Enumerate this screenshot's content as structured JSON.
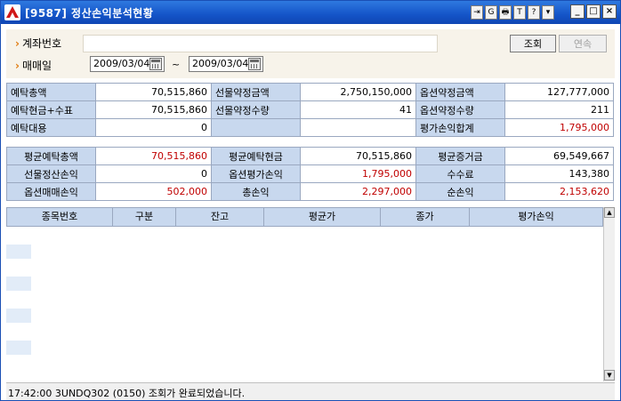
{
  "window": {
    "title": "[9587] 정산손익분석현황",
    "tools": [
      "⇥",
      "G",
      "🖶",
      "T",
      "?"
    ],
    "controls": [
      "_",
      "□",
      "×"
    ]
  },
  "search": {
    "account_label": "계좌번호",
    "account_value": "",
    "date_label": "매매일",
    "date_from": "2009/03/04",
    "date_to": "2009/03/04",
    "range_sep": "~",
    "query_button": "조회",
    "next_button": "연속"
  },
  "summary1": [
    [
      {
        "label": "예탁총액",
        "value": "70,515,860"
      },
      {
        "label": "선물약정금액",
        "value": "2,750,150,000"
      },
      {
        "label": "옵션약정금액",
        "value": "127,777,000"
      }
    ],
    [
      {
        "label": "예탁현금+수표",
        "value": "70,515,860"
      },
      {
        "label": "선물약정수량",
        "value": "41"
      },
      {
        "label": "옵션약정수량",
        "value": "211"
      }
    ],
    [
      {
        "label": "예탁대용",
        "value": "0"
      },
      {
        "label": "",
        "value": ""
      },
      {
        "label": "평가손익합계",
        "value": "1,795,000"
      }
    ]
  ],
  "summary2": [
    [
      {
        "label": "평균예탁총액",
        "value": "70,515,860"
      },
      {
        "label": "평균예탁현금",
        "value": "70,515,860"
      },
      {
        "label": "평균증거금",
        "value": "69,549,667"
      }
    ],
    [
      {
        "label": "선물정산손익",
        "value": "0"
      },
      {
        "label": "옵션평가손익",
        "value": "1,795,000"
      },
      {
        "label": "수수료",
        "value": "143,380"
      }
    ],
    [
      {
        "label": "옵션매매손익",
        "value": "502,000"
      },
      {
        "label": "총손익",
        "value": "2,297,000"
      },
      {
        "label": "순손익",
        "value": "2,153,620"
      }
    ]
  ],
  "colors": {
    "label_bg": "#c8d8ee",
    "negative_red": "#c00000",
    "title_bar": "#1454c8",
    "accent_arrow": "#e07b10"
  },
  "list": {
    "columns": [
      "종목번호",
      "구분",
      "잔고",
      "평균가",
      "종가",
      "평가손익"
    ],
    "rows": []
  },
  "status": {
    "message": "17:42:00 3UNDQ302 (0150) 조회가 완료되었습니다."
  }
}
